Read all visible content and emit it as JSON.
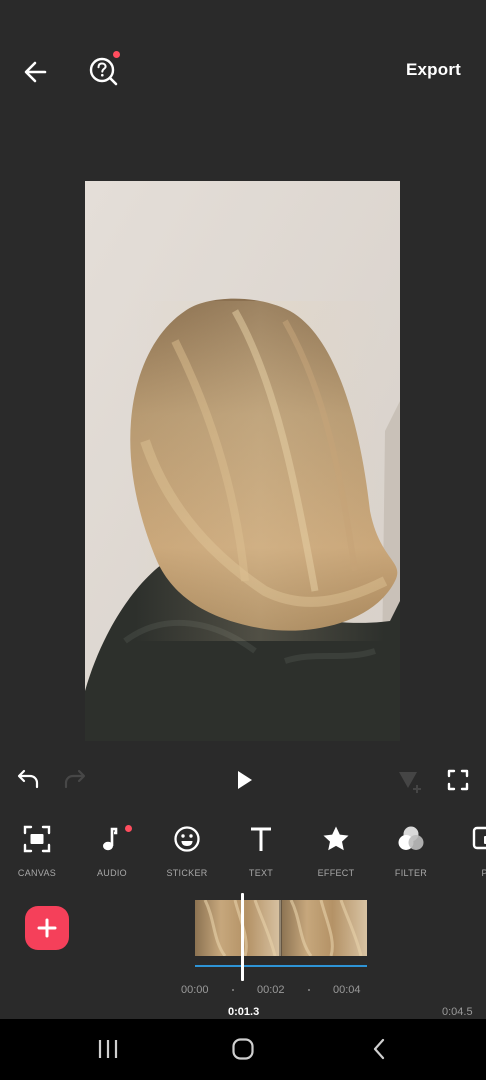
{
  "header": {
    "export_label": "Export",
    "back_icon": "arrow-left-icon",
    "help_icon": "question-search-icon",
    "accent_dot": "#ff4d5e"
  },
  "preview": {
    "content": "photo"
  },
  "playback": {
    "undo_icon": "undo-icon",
    "redo_icon": "redo-icon",
    "play_icon": "play-icon",
    "keyframe_icon": "keyframe-icon",
    "fullscreen_icon": "fullscreen-icon"
  },
  "toolbar": {
    "items": [
      {
        "label": "CANVAS",
        "icon": "canvas-icon"
      },
      {
        "label": "AUDIO",
        "icon": "music-note-icon"
      },
      {
        "label": "STICKER",
        "icon": "smiley-icon"
      },
      {
        "label": "TEXT",
        "icon": "text-icon"
      },
      {
        "label": "EFFECT",
        "icon": "star-icon"
      },
      {
        "label": "FILTER",
        "icon": "filter-icon"
      },
      {
        "label": "PI",
        "icon": "pip-icon"
      }
    ]
  },
  "timeline": {
    "add_icon": "plus-icon",
    "add_color": "#f5405a",
    "track_color": "#2e94d6",
    "ticks": [
      "00:00",
      "00:02",
      "00:04"
    ],
    "current_time": "0:01.3",
    "total_time": "0:04.5"
  },
  "navbar": {
    "recents_icon": "recents-icon",
    "home_icon": "home-icon",
    "back_icon": "nav-back-icon"
  }
}
